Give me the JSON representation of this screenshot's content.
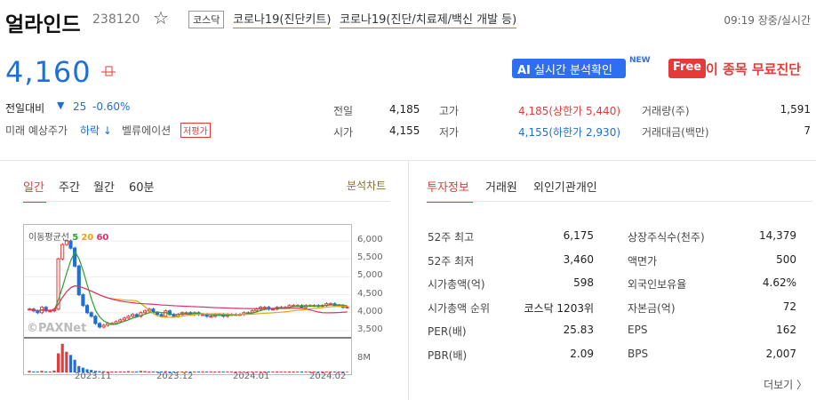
{
  "header": {
    "name": "얼라인드",
    "code": "238120",
    "market": "코스닥",
    "themes": [
      "코로나19(진단키트)",
      "코로나19(진단/치료제/백신 개발 등)"
    ],
    "time": "09:19 장중/실시간"
  },
  "price": {
    "current": "4,160",
    "change_label": "전일대비",
    "change_arrow": "▼",
    "change_value": "25",
    "change_pct": "-0.60%",
    "future_label": "미래 예상주가",
    "future_value": "하락 ↓",
    "valuation_label": "벨류에이션",
    "valuation_badge": "저평가"
  },
  "actions": {
    "ai_label": "AI",
    "ai_text": "실시간 분석확인",
    "new_label": "NEW",
    "free_label": "Free",
    "free_text": "이 종목 무료진단"
  },
  "quote": {
    "prev_label": "전일",
    "prev": "4,185",
    "open_label": "시가",
    "open": "4,155",
    "high_label": "고가",
    "high": "4,185(상한가 5,440)",
    "low_label": "저가",
    "low": "4,155(하한가 2,930)",
    "volume_label": "거래량(주)",
    "volume": "1,591",
    "amount_label": "거래대금(백만)",
    "amount": "7"
  },
  "chart_tabs": [
    "일간",
    "주간",
    "월간",
    "60분"
  ],
  "chart_link": "분석차트",
  "chart": {
    "ma_label": "이동평균선",
    "ma": [
      "5",
      "20",
      "60"
    ],
    "ma_colors": [
      "#2ca02c",
      "#e8a317",
      "#d6336c"
    ],
    "watermark": "©PAXNet",
    "yticks": [
      "6,000",
      "5,500",
      "5,000",
      "4,500",
      "4,000",
      "3,500"
    ],
    "vol_tick": "8M",
    "xticks": [
      "2023.11",
      "2023.12",
      "2024.01",
      "2024.02"
    ]
  },
  "chart_data": {
    "type": "candlestick",
    "ylim": [
      3400,
      6200
    ],
    "close": [
      4100,
      4050,
      4000,
      4150,
      4050,
      4050,
      4100,
      5500,
      5900,
      6000,
      5800,
      5300,
      4500,
      4200,
      4000,
      3900,
      3700,
      3600,
      3650,
      3700,
      3700,
      3750,
      3800,
      3850,
      3900,
      3950,
      3900,
      4000,
      4050,
      4100,
      4000,
      3950,
      3900,
      4050,
      3950,
      3900,
      3950,
      4000,
      4000,
      3950,
      4000,
      3950,
      3950,
      3900,
      3900,
      3950,
      3950,
      3900,
      3950,
      3950,
      3950,
      3950,
      4000,
      4000,
      4050,
      4100,
      4150,
      4150,
      4100,
      4100,
      4150,
      4150,
      4150,
      4200,
      4200,
      4200,
      4150,
      4200,
      4200,
      4200,
      4180,
      4200,
      4250,
      4250,
      4200,
      4200,
      4150,
      4160
    ],
    "volume": [
      0.5,
      0.3,
      0.3,
      0.5,
      0.3,
      0.3,
      0.6,
      6.0,
      9.0,
      6.5,
      5.5,
      4.0,
      2.0,
      1.5,
      1.0,
      0.8,
      0.5,
      0.4,
      0.4,
      0.3,
      0.3,
      0.3,
      0.3,
      0.3,
      0.4,
      0.3,
      0.3,
      0.5,
      0.4,
      0.3,
      0.3,
      0.3,
      0.3,
      0.4,
      0.3,
      0.3,
      0.3,
      0.3,
      0.3,
      0.3,
      0.3,
      0.3,
      0.3,
      0.3,
      0.3,
      0.3,
      0.3,
      0.3,
      0.3,
      0.3,
      0.3,
      0.3,
      0.3,
      0.3,
      0.3,
      0.3,
      0.3,
      0.3,
      0.3,
      0.3,
      0.3,
      0.3,
      0.3,
      0.3,
      0.3,
      0.3,
      0.3,
      0.3,
      0.3,
      0.3,
      0.3,
      0.3,
      0.3,
      0.3,
      0.3,
      0.3,
      0.3,
      0.2
    ]
  },
  "info_tabs": [
    "투자정보",
    "거래원",
    "외인기관개인"
  ],
  "info_left": [
    {
      "label": "52주 최고",
      "value": "6,175"
    },
    {
      "label": "52주 최저",
      "value": "3,460"
    },
    {
      "label": "시가총액(억)",
      "value": "598"
    },
    {
      "label": "시가총액 순위",
      "value": "코스닥 1203위"
    },
    {
      "label": "PER(배)",
      "value": "25.83"
    },
    {
      "label": "PBR(배)",
      "value": "2.09"
    }
  ],
  "info_right": [
    {
      "label": "상장주식수(천주)",
      "value": "14,379"
    },
    {
      "label": "액면가",
      "value": "500"
    },
    {
      "label": "외국인보유율",
      "value": "4.62%"
    },
    {
      "label": "자본금(억)",
      "value": "72"
    },
    {
      "label": "EPS",
      "value": "162"
    },
    {
      "label": "BPS",
      "value": "2,007"
    }
  ],
  "more_label": "더보기 〉"
}
